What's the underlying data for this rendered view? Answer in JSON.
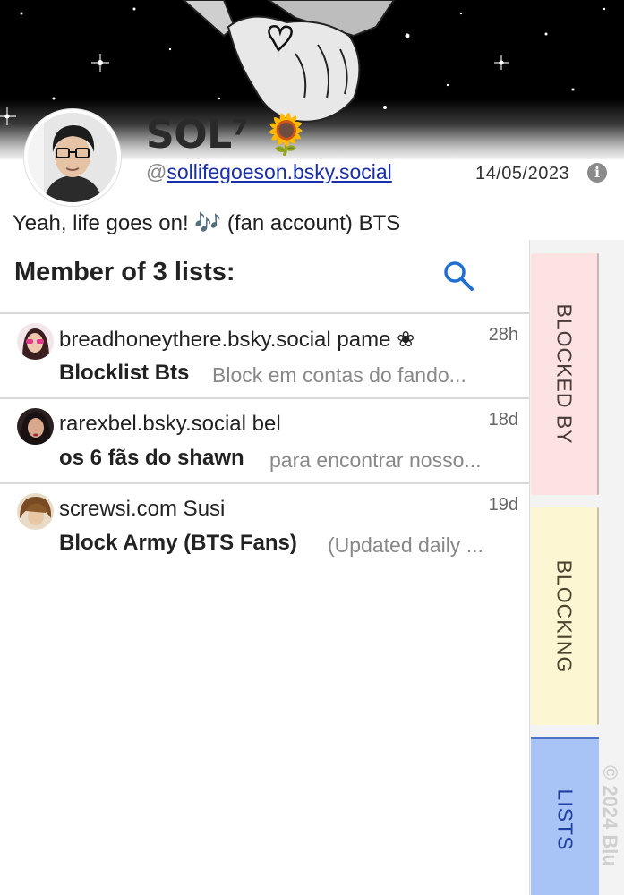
{
  "profile": {
    "display_name": "SOL⁷ 🌻",
    "handle_prefix": "@",
    "handle": "sollifegoeson.bsky.social",
    "joined": "14/05/2023",
    "info_glyph": "i",
    "bio": "Yeah, life goes on! 🎶  (fan account) BTS"
  },
  "lists_section": {
    "header": "Member of 3 lists:",
    "items": [
      {
        "owner": "breadhoneythere.bsky.social pame ❀",
        "age": "28h",
        "title": "Blocklist Bts",
        "description": "Block em contas do fando...",
        "avatar_color": "#c94a6e"
      },
      {
        "owner": "rarexbel.bsky.social bel",
        "age": "18d",
        "title": "os 6 fãs do shawn",
        "description": "para encontrar nosso...",
        "avatar_color": "#3a2a2a"
      },
      {
        "owner": "screwsi.com Susi",
        "age": "19d",
        "title": "Block Army (BTS Fans)",
        "description": "(Updated daily ...",
        "avatar_color": "#7a5030"
      }
    ]
  },
  "tabs": {
    "blocked_by": "BLOCKED BY",
    "blocking": "BLOCKING",
    "lists": "LISTS"
  },
  "footer": {
    "copyright": "© 2024 Blu"
  },
  "colors": {
    "blocked_by_bg": "#fce3e2",
    "blocking_bg": "#fdf6d2",
    "lists_bg": "#a8c4f6",
    "link": "#1a2fa8",
    "search_icon": "#1f6fd0"
  }
}
